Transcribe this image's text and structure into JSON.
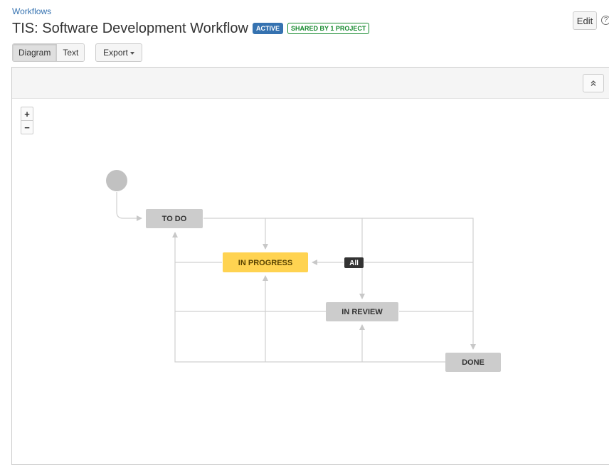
{
  "breadcrumb": {
    "label": "Workflows"
  },
  "header": {
    "title": "TIS: Software Development Workflow",
    "status_lozenge": "ACTIVE",
    "shared_lozenge": "SHARED BY 1 PROJECT",
    "edit_label": "Edit",
    "help_icon": "question-circle-icon"
  },
  "toolbar": {
    "view_tabs": [
      {
        "label": "Diagram",
        "active": true
      },
      {
        "label": "Text",
        "active": false
      }
    ],
    "export_label": "Export"
  },
  "diagram": {
    "zoom_in_label": "+",
    "zoom_out_label": "−",
    "collapse_icon": "double-chevron-up-icon",
    "all_transition_label": "All",
    "statuses": [
      {
        "id": "todo",
        "label": "TO DO"
      },
      {
        "id": "in-progress",
        "label": "IN PROGRESS",
        "highlighted": true
      },
      {
        "id": "in-review",
        "label": "IN REVIEW"
      },
      {
        "id": "done",
        "label": "DONE"
      }
    ]
  },
  "colors": {
    "link": "#3572b0",
    "active_lozenge": "#3572b0",
    "shared_lozenge": "#14892c",
    "status_default": "#cccccc",
    "status_highlight": "#ffd351",
    "transition_line": "#cfcfcf",
    "all_badge": "#333333"
  }
}
